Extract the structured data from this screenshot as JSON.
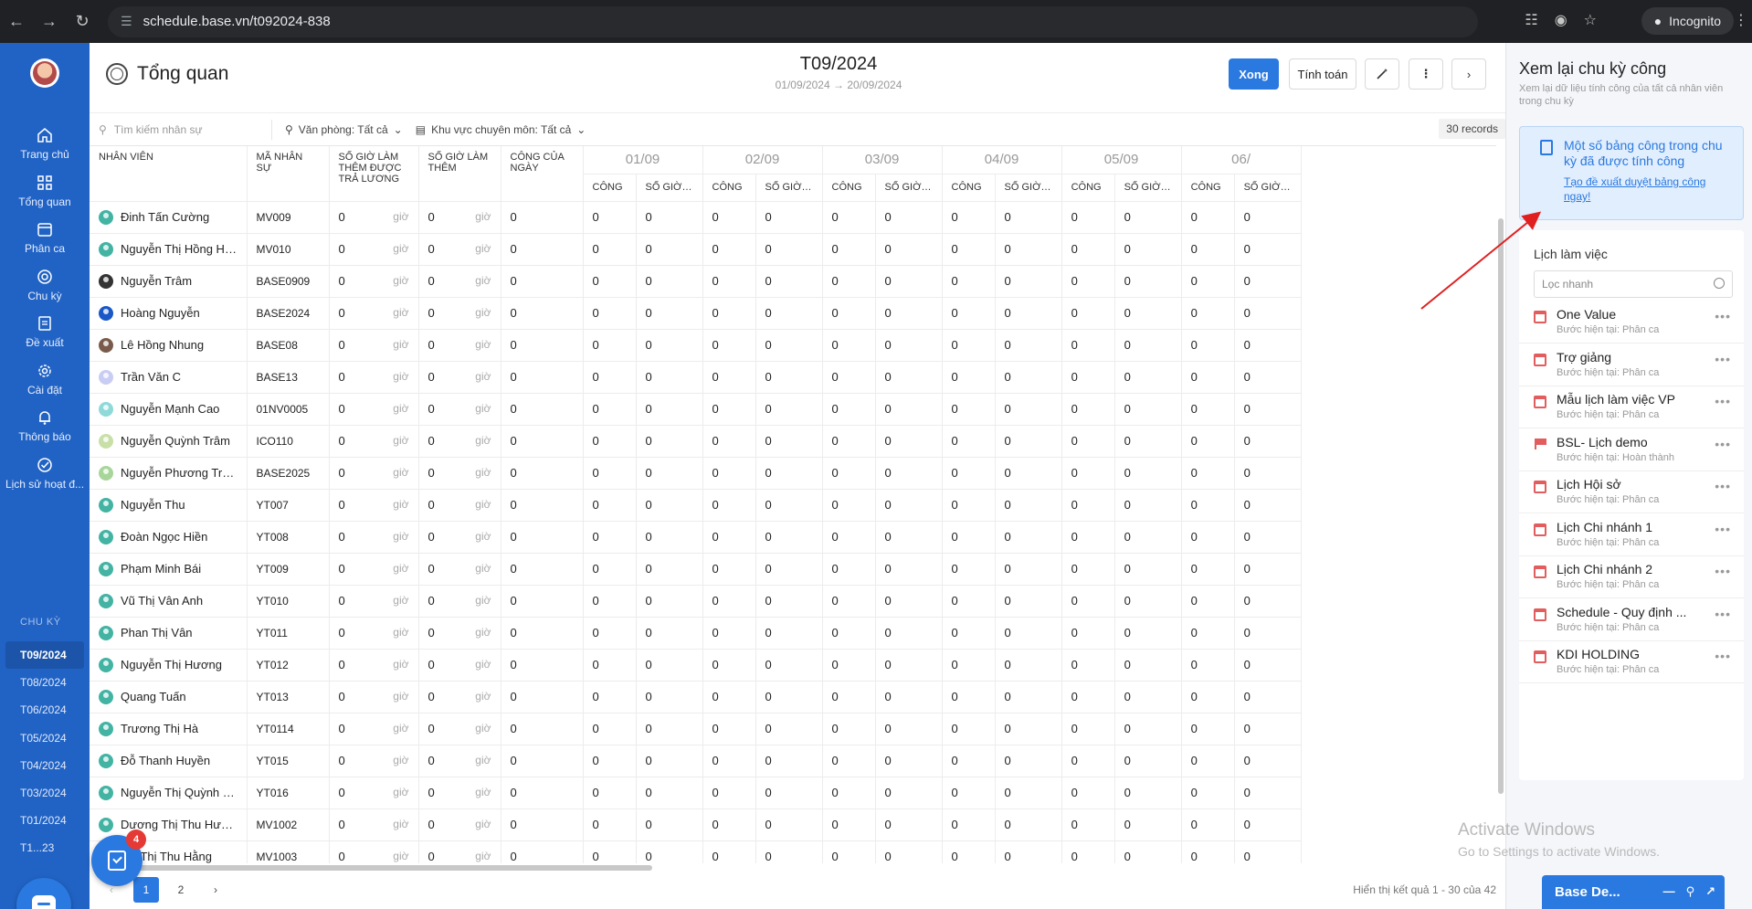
{
  "browser": {
    "url": "schedule.base.vn/t092024-838",
    "incognito_label": "Incognito"
  },
  "sidebar": {
    "items": [
      {
        "label": "Trang chủ",
        "icon": "home-icon"
      },
      {
        "label": "Tổng quan",
        "icon": "grid-icon"
      },
      {
        "label": "Phân ca",
        "icon": "calendar-icon"
      },
      {
        "label": "Chu kỳ",
        "icon": "cycle-icon"
      },
      {
        "label": "Đề xuất",
        "icon": "document-icon"
      },
      {
        "label": "Cài đặt",
        "icon": "gear-icon"
      },
      {
        "label": "Thông báo",
        "icon": "bell-icon"
      },
      {
        "label": "Lịch sử hoạt đ...",
        "icon": "check-circle-icon"
      }
    ],
    "cycle_title": "CHU KỲ",
    "cycles": [
      "T09/2024",
      "T08/2024",
      "T06/2024",
      "T05/2024",
      "T04/2024",
      "T03/2024",
      "T01/2024",
      "T1...23"
    ]
  },
  "header": {
    "title": "Tổng quan",
    "period_title": "T09/2024",
    "period_range": "01/09/2024 → 20/09/2024",
    "btn_done": "Xong",
    "btn_calc": "Tính toán"
  },
  "filters": {
    "search_placeholder": "Tìm kiếm nhân sự",
    "office": "Văn phòng: Tất cả",
    "area": "Khu vực chuyên môn: Tất cả",
    "records": "30 records"
  },
  "table": {
    "headers": {
      "employee": "NHÂN VIÊN",
      "code": "MÃ NHÂN SỰ",
      "paid_ot": "SỐ GIỜ LÀM THÊM ĐƯỢC TRẢ LƯƠNG",
      "ot": "SỐ GIỜ LÀM THÊM",
      "daily": "CÔNG CỦA NGÀY"
    },
    "days": [
      "01/09",
      "02/09",
      "03/09",
      "04/09",
      "05/09",
      "06/"
    ],
    "sub_cong": "CÔNG",
    "sub_hours": "SỐ GIỜ LÀM ...",
    "unit": "giờ",
    "rows": [
      {
        "name": "Đinh Tấn Cường",
        "code": "MV009",
        "avatar": "#43b3a4"
      },
      {
        "name": "Nguyễn Thị Hồng Hạnh",
        "code": "MV010",
        "avatar": "#43b3a4"
      },
      {
        "name": "Nguyễn Trâm",
        "code": "BASE0909",
        "avatar": "#333333"
      },
      {
        "name": "Hoàng Nguyễn",
        "code": "BASE2024",
        "avatar": "#1a58c8"
      },
      {
        "name": "Lê Hồng Nhung",
        "code": "BASE08",
        "avatar": "#7a5b4b"
      },
      {
        "name": "Trần Văn C",
        "code": "BASE13",
        "avatar": "#c9cdf3"
      },
      {
        "name": "Nguyễn Mạnh Cao",
        "code": "01NV0005",
        "avatar": "#8fd9d9"
      },
      {
        "name": "Nguyễn Quỳnh Trâm",
        "code": "ICO110",
        "avatar": "#c8e0a8"
      },
      {
        "name": "Nguyễn Phương Trang",
        "code": "BASE2025",
        "avatar": "#a8d69a"
      },
      {
        "name": "Nguyễn Thu",
        "code": "YT007",
        "avatar": "#43b3a4"
      },
      {
        "name": "Đoàn Ngọc Hiền",
        "code": "YT008",
        "avatar": "#43b3a4"
      },
      {
        "name": "Phạm Minh Bái",
        "code": "YT009",
        "avatar": "#43b3a4"
      },
      {
        "name": "Vũ Thị Vân Anh",
        "code": "YT010",
        "avatar": "#43b3a4"
      },
      {
        "name": "Phan Thị Vân",
        "code": "YT011",
        "avatar": "#43b3a4"
      },
      {
        "name": "Nguyễn Thị Hương",
        "code": "YT012",
        "avatar": "#43b3a4"
      },
      {
        "name": "Quang Tuấn",
        "code": "YT013",
        "avatar": "#43b3a4"
      },
      {
        "name": "Trương Thị Hà",
        "code": "YT0114",
        "avatar": "#43b3a4"
      },
      {
        "name": "Đỗ Thanh Huyền",
        "code": "YT015",
        "avatar": "#43b3a4"
      },
      {
        "name": "Nguyễn Thị Quỳnh Phươ...",
        "code": "YT016",
        "avatar": "#43b3a4"
      },
      {
        "name": "Dương Thị Thu Hương",
        "code": "MV1002",
        "avatar": "#43b3a4"
      },
      {
        "name": "...n Thị Thu Hằng",
        "code": "MV1003",
        "avatar": "#43b3a4"
      }
    ],
    "zero": "0"
  },
  "footer": {
    "pages": [
      "1",
      "2"
    ],
    "result": "Hiển thị kết quả 1 - 30 của 42"
  },
  "task_badge": "4",
  "rpanel": {
    "title": "Xem lại chu kỳ công",
    "subtitle": "Xem lại dữ liệu tính công của tất cả nhân viên trong chu kỳ",
    "notice_text": "Một số bảng công trong chu kỳ đã được tính công",
    "notice_link": "Tạo đề xuất duyệt bảng công ngay!",
    "schedule_title": "Lịch làm việc",
    "filter_placeholder": "Lọc nhanh",
    "schedules": [
      {
        "name": "One Value",
        "status": "Bước hiện tại: Phân ca",
        "icon": "calendar-icon"
      },
      {
        "name": "Trợ giảng",
        "status": "Bước hiện tại: Phân ca",
        "icon": "calendar-icon"
      },
      {
        "name": "Mẫu lịch làm việc VP",
        "status": "Bước hiện tại: Phân ca",
        "icon": "calendar-icon"
      },
      {
        "name": "BSL- Lịch demo",
        "status": "Bước hiện tại: Hoàn thành",
        "icon": "flag-icon"
      },
      {
        "name": "Lịch Hội sở",
        "status": "Bước hiện tại: Phân ca",
        "icon": "calendar-icon"
      },
      {
        "name": "Lịch Chi nhánh 1",
        "status": "Bước hiện tại: Phân ca",
        "icon": "calendar-icon"
      },
      {
        "name": "Lịch Chi nhánh 2",
        "status": "Bước hiện tại: Phân ca",
        "icon": "calendar-icon"
      },
      {
        "name": "Schedule - Quy định ...",
        "status": "Bước hiện tại: Phân ca",
        "icon": "calendar-icon"
      },
      {
        "name": "KDI HOLDING",
        "status": "Bước hiện tại: Phân ca",
        "icon": "calendar-icon"
      }
    ]
  },
  "watermark": {
    "line1": "Activate Windows",
    "line2": "Go to Settings to activate Windows."
  },
  "base_widget": {
    "label": "Base De..."
  },
  "colors": {
    "primary": "#2a79e0",
    "sidebar": "#2163c4",
    "annotation_arrow": "#e02020"
  }
}
